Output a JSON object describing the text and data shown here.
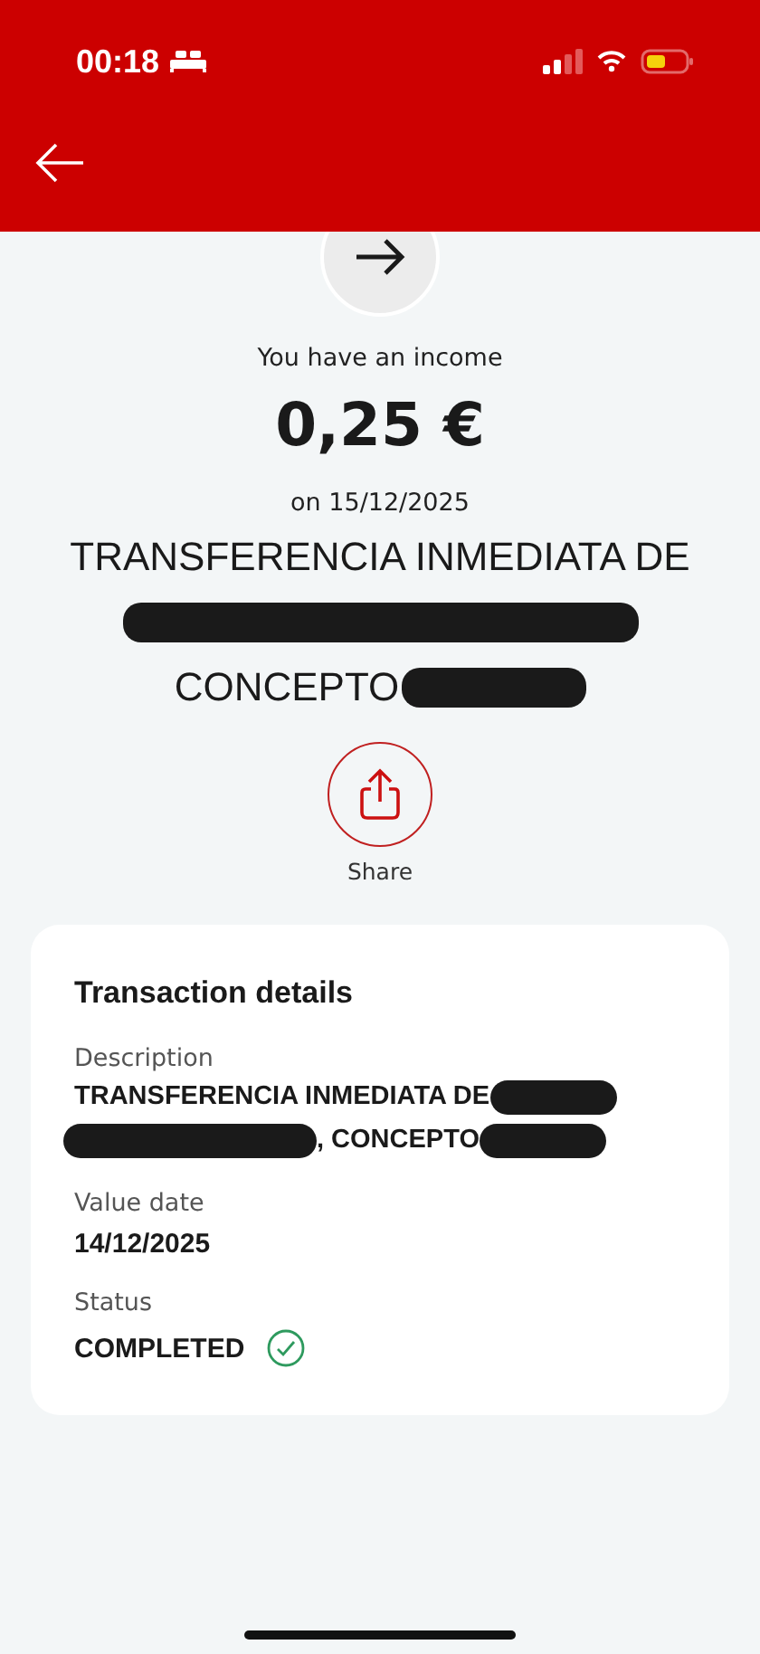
{
  "status_bar": {
    "time": "00:18"
  },
  "summary": {
    "caption": "You have an income",
    "amount": "0,25 €",
    "date": "on 15/12/2025",
    "lines": [
      [
        {
          "kind": "text",
          "text": "TRANSFERENCIA INMEDIATA DE"
        }
      ],
      [
        {
          "kind": "redacted"
        }
      ],
      [
        {
          "kind": "text",
          "text": "CONCEPTO"
        },
        {
          "kind": "redacted"
        }
      ]
    ]
  },
  "share": {
    "label": "Share"
  },
  "details": {
    "title": "Transaction details",
    "fields": [
      {
        "kind": "lines",
        "label": "Description",
        "lines": [
          [
            {
              "kind": "text",
              "text": "TRANSFERENCIA INMEDIATA DE"
            },
            {
              "kind": "redacted"
            }
          ],
          [
            {
              "kind": "redacted"
            },
            {
              "kind": "text",
              "text": ", CONCEPTO"
            },
            {
              "kind": "redacted"
            }
          ]
        ]
      },
      {
        "kind": "value",
        "label": "Value date",
        "value": "14/12/2025"
      },
      {
        "kind": "status",
        "label": "Status",
        "value": "COMPLETED",
        "completed": true
      }
    ]
  }
}
